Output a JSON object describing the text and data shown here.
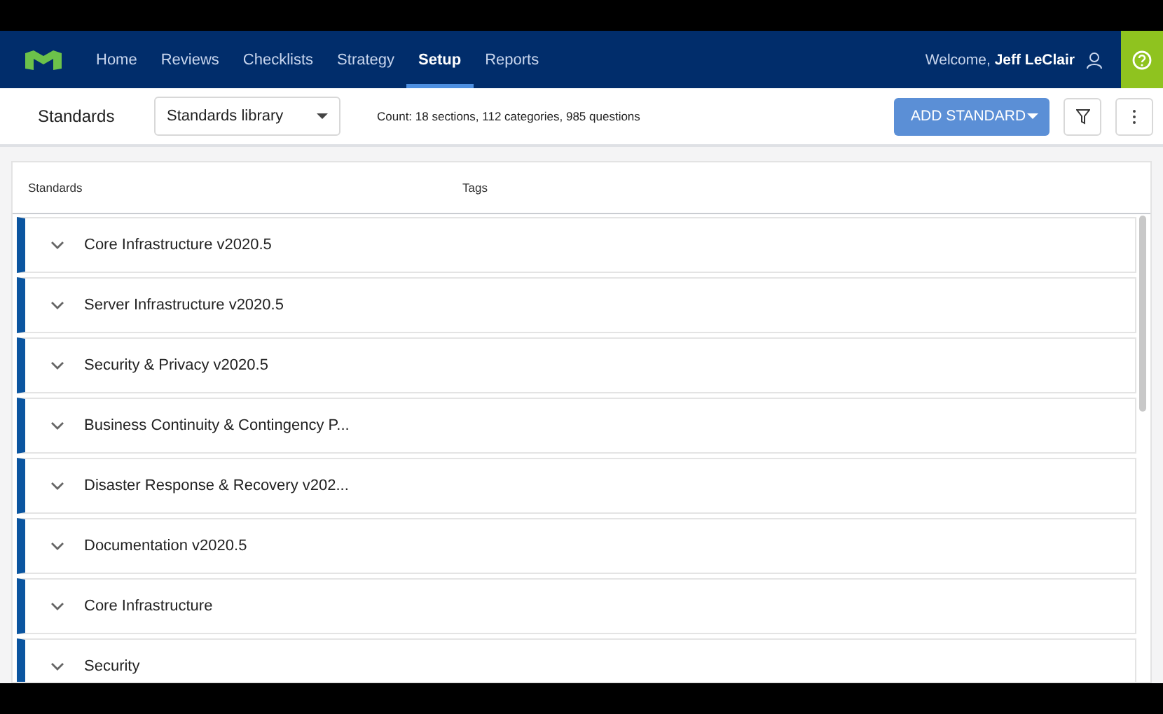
{
  "nav": {
    "items": [
      {
        "label": "Home",
        "selected": false
      },
      {
        "label": "Reviews",
        "selected": false
      },
      {
        "label": "Checklists",
        "selected": false
      },
      {
        "label": "Strategy",
        "selected": false
      },
      {
        "label": "Setup",
        "selected": true
      },
      {
        "label": "Reports",
        "selected": false
      }
    ],
    "welcome": "Welcome, **Jeff LeClair**"
  },
  "toolbar": {
    "title": "Standards",
    "library": "Standards library",
    "count": "Count: 18 sections, 112 categories, 985 questions",
    "add_button": "ADD STANDARD"
  },
  "table": {
    "columns": [
      "Standards",
      "Tags"
    ],
    "rows": [
      {
        "name": "Core Infrastructure v2020.5",
        "expanded": false
      },
      {
        "name": "Server Infrastructure v2020.5",
        "expanded": false
      },
      {
        "name": "Security & Privacy v2020.5",
        "expanded": false
      },
      {
        "name": "Business Continuity & Contingency P...",
        "expanded": false
      },
      {
        "name": "Disaster Response & Recovery v202...",
        "expanded": false
      },
      {
        "name": "Documentation v2020.5",
        "expanded": false
      },
      {
        "name": "Core Infrastructure",
        "expanded": false
      },
      {
        "name": "Security",
        "expanded": false
      }
    ]
  }
}
